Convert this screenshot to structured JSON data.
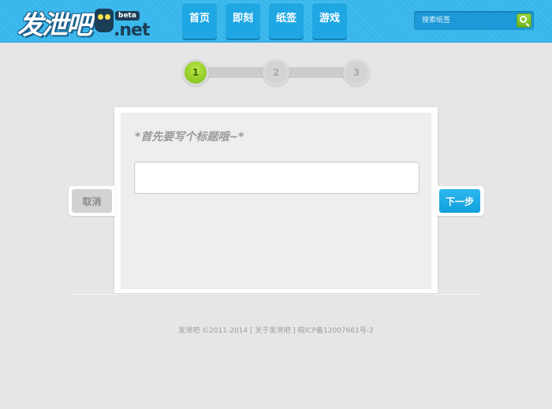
{
  "header": {
    "logo_main": "发泄吧",
    "logo_beta": "beta",
    "logo_net": ".net",
    "nav": [
      {
        "label": "首页"
      },
      {
        "label": "即刻"
      },
      {
        "label": "纸签"
      },
      {
        "label": "游戏"
      }
    ],
    "search": {
      "placeholder": "搜索纸签"
    }
  },
  "steps": {
    "items": [
      "1",
      "2",
      "3"
    ],
    "current": 1
  },
  "form": {
    "hint": "*首先要写个标题哦~*",
    "title_value": "",
    "cancel_label": "取消",
    "next_label": "下一步"
  },
  "footer": {
    "copyright": "发泄吧 ©2011-2014",
    "about_link": "[ 关于发泄吧 ]",
    "icp": "皖ICP备12007661号-2"
  },
  "colors": {
    "header_bg": "#37b6ec",
    "nav_bg": "#1fa7e4",
    "step_active": "#7cbd12",
    "next_button": "#129fdb",
    "page_bg": "#e6e6e6"
  }
}
